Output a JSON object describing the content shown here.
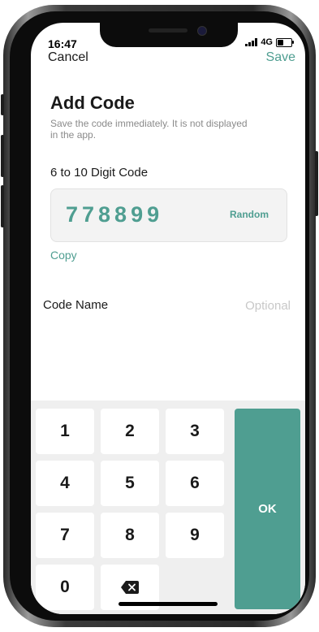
{
  "status_bar": {
    "time": "16:47",
    "network": "4G",
    "battery_level": 0.45
  },
  "nav": {
    "cancel_label": "Cancel",
    "save_label": "Save"
  },
  "content": {
    "title": "Add Code",
    "subtitle": "Save the code immediately. It is not displayed in the app.",
    "code_label": "6 to 10 Digit Code",
    "code_value": "778899",
    "random_label": "Random",
    "copy_label": "Copy",
    "name_label": "Code Name",
    "name_placeholder": "Optional"
  },
  "keypad": {
    "keys": [
      "1",
      "2",
      "3",
      "4",
      "5",
      "6",
      "7",
      "8",
      "9",
      "0"
    ],
    "ok_label": "OK",
    "backspace_icon": "backspace-icon"
  },
  "colors": {
    "accent": "#4f9e91",
    "keypad_bg": "#efefef",
    "key_bg": "#ffffff"
  }
}
